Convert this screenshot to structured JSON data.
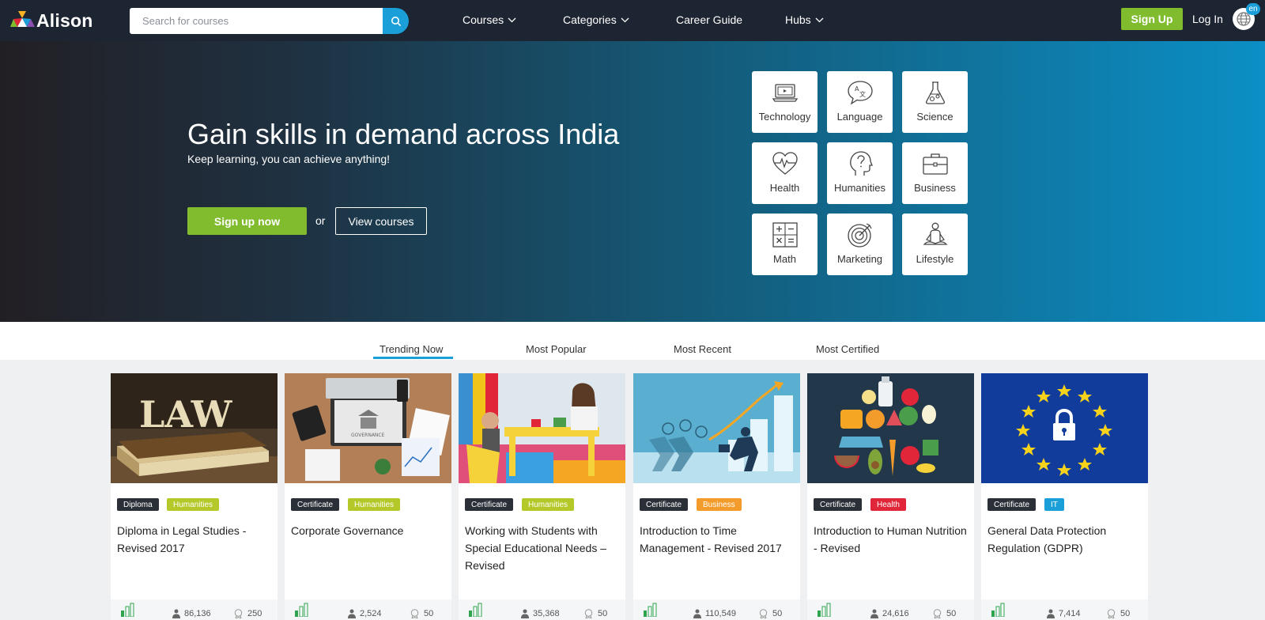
{
  "brand": {
    "name": "Alison"
  },
  "header": {
    "search_placeholder": "Search for courses",
    "nav": [
      {
        "label": "Courses",
        "dropdown": true
      },
      {
        "label": "Categories",
        "dropdown": true
      },
      {
        "label": "Career Guide",
        "dropdown": false
      },
      {
        "label": "Hubs",
        "dropdown": true
      }
    ],
    "signup_label": "Sign Up",
    "login_label": "Log In",
    "language": "en"
  },
  "hero": {
    "title": "Gain skills in demand across India",
    "subtitle": "Keep learning, you can achieve anything!",
    "primary_cta": "Sign up now",
    "or_text": "or",
    "secondary_cta": "View courses",
    "categories": [
      {
        "label": "Technology",
        "icon": "laptop-icon"
      },
      {
        "label": "Language",
        "icon": "speech-bubble-icon"
      },
      {
        "label": "Science",
        "icon": "flask-icon"
      },
      {
        "label": "Health",
        "icon": "heartbeat-icon"
      },
      {
        "label": "Humanities",
        "icon": "question-head-icon"
      },
      {
        "label": "Business",
        "icon": "briefcase-icon"
      },
      {
        "label": "Math",
        "icon": "calculator-icon"
      },
      {
        "label": "Marketing",
        "icon": "target-icon"
      },
      {
        "label": "Lifestyle",
        "icon": "meditation-icon"
      }
    ]
  },
  "tabs": [
    {
      "label": "Trending Now",
      "active": true
    },
    {
      "label": "Most Popular",
      "active": false
    },
    {
      "label": "Most Recent",
      "active": false
    },
    {
      "label": "Most Certified",
      "active": false
    }
  ],
  "courses": [
    {
      "type": "Diploma",
      "category": "Humanities",
      "category_color": "#b5c829",
      "title": "Diploma in Legal Studies - Revised 2017",
      "learners": "86,136",
      "likes": "250",
      "image": "law-book"
    },
    {
      "type": "Certificate",
      "category": "Humanities",
      "category_color": "#b5c829",
      "title": "Corporate Governance",
      "learners": "2,524",
      "likes": "50",
      "image": "governance-desk"
    },
    {
      "type": "Certificate",
      "category": "Humanities",
      "category_color": "#b5c829",
      "title": "Working with Students with Special Educational Needs – Revised",
      "learners": "35,368",
      "likes": "50",
      "image": "classroom"
    },
    {
      "type": "Certificate",
      "category": "Business",
      "category_color": "#f39c2b",
      "title": "Introduction to Time Management - Revised 2017",
      "learners": "110,549",
      "likes": "50",
      "image": "time-chart"
    },
    {
      "type": "Certificate",
      "category": "Health",
      "category_color": "#e2263a",
      "title": "Introduction to Human Nutrition - Revised",
      "learners": "24,616",
      "likes": "50",
      "image": "nutrition-food"
    },
    {
      "type": "Certificate",
      "category": "IT",
      "category_color": "#1a9fd9",
      "title": "General Data Protection Regulation (GDPR)",
      "learners": "7,414",
      "likes": "50",
      "image": "eu-lock"
    }
  ],
  "colors": {
    "header_bg": "#1e2532",
    "accent_green": "#81bc2f",
    "accent_blue": "#1a9fd9"
  }
}
